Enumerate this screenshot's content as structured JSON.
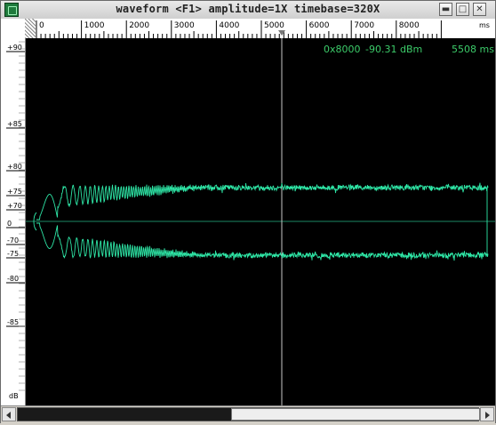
{
  "window": {
    "title": "waveform  <F1> amplitude=1X timebase=320X",
    "buttons": [
      "minimize",
      "maximize",
      "close"
    ]
  },
  "ruler": {
    "labels": [
      "0",
      "1000",
      "2000",
      "3000",
      "4000",
      "5000",
      "6000",
      "7000",
      "8000"
    ],
    "end_label": "ms"
  },
  "scale": {
    "labels": [
      "+90",
      "+85",
      "+80",
      "+75",
      "+70",
      "0",
      "-70",
      "-75",
      "-80",
      "-85"
    ],
    "unit": "dB"
  },
  "readout": {
    "address": "0x8000",
    "level": "-90.31 dBm",
    "time": "5508 ms"
  },
  "colors": {
    "trace": "#2ee6a6",
    "text": "#3ccc6a",
    "cursor": "#c8c8c8"
  }
}
